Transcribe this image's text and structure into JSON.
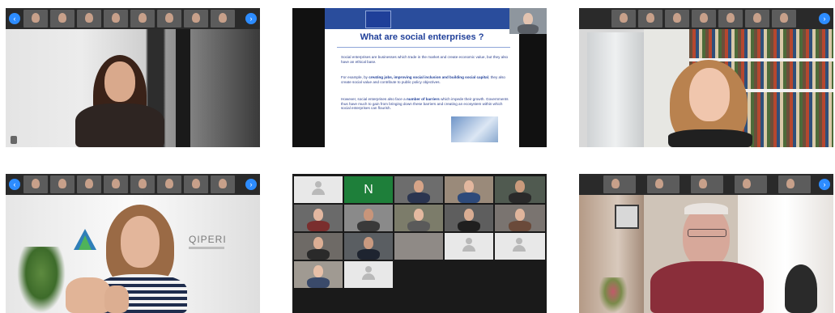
{
  "shots": {
    "s1": {
      "name_tag": ""
    },
    "s2": {
      "title": "What are social enterprises ?",
      "p1": "Social enterprises are businesses which trade in the market and create economic value, but they also have an ethical base.",
      "p2a": "For example, by ",
      "p2b": "creating jobs, improving social inclusion and building social capital",
      "p2c": ", they also create social value and contribute to public policy objectives.",
      "p3a": "However, social enterprises also face a ",
      "p3b": "number of barriers",
      "p3c": " which impede their growth. Governments thus have much to gain from bringing down these barriers and creating an ecosystem within which social enterprises can flourish."
    },
    "s4": {
      "logo_text": "QIPERI"
    },
    "s5": {
      "initial": "N"
    }
  },
  "colors": {
    "zoom_blue": "#2d8cff",
    "slide_blue": "#1f3f99",
    "initial_green": "#1e7f3a"
  },
  "icons": [
    "chevron-left-icon",
    "chevron-right-icon",
    "mic-icon",
    "avatar-placeholder-icon",
    "eu-flag-icon"
  ]
}
